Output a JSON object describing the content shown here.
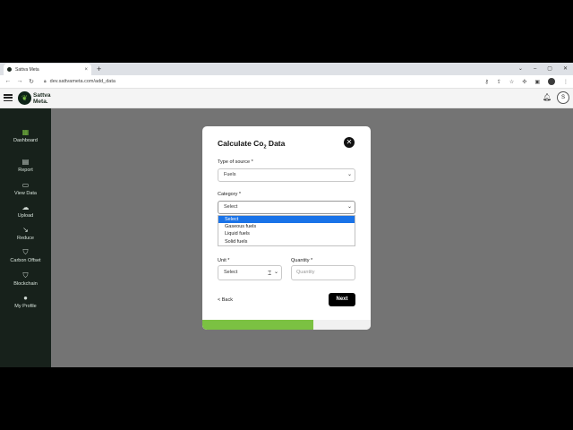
{
  "browser": {
    "tab_title": "Sattva Meta",
    "tab_close": "×",
    "new_tab": "+",
    "url": "dev.sattvameta.com/add_data",
    "window_controls": [
      "⌄",
      "–",
      "▢",
      "✕"
    ]
  },
  "header": {
    "logo_text_line1": "Sattva",
    "logo_text_line2": "Meta.",
    "avatar_initial": "S"
  },
  "sidebar": {
    "items": [
      {
        "label": "Dashboard",
        "icon": "dashboard-icon",
        "active": true
      },
      {
        "label": "Report",
        "icon": "report-icon"
      },
      {
        "label": "View Data",
        "icon": "monitor-icon"
      },
      {
        "label": "Upload",
        "icon": "cloud-upload-icon"
      },
      {
        "label": "Reduce",
        "icon": "trend-down-icon"
      },
      {
        "label": "Carbon Offset",
        "icon": "shield-icon"
      },
      {
        "label": "Blockchain",
        "icon": "shield-check-icon"
      },
      {
        "label": "My Profile",
        "icon": "person-icon"
      }
    ]
  },
  "modal": {
    "title_main": "Calculate Co",
    "title_sub": "2",
    "title_end": " Data",
    "type_of_source_label": "Type of source *",
    "type_of_source_value": "Fuels",
    "category_label": "Category *",
    "category_value": "Select",
    "category_options": [
      "Select",
      "Gaseous fuels",
      "Liquid fuels",
      "Solid fuels"
    ],
    "unit_label": "Unit *",
    "unit_value": "Select",
    "quantity_label": "Quantity *",
    "quantity_placeholder": "Quantity",
    "back_label": "< Back",
    "next_label": "Next",
    "progress_fraction": 0.66
  },
  "colors": {
    "accent_green": "#7bc142",
    "sidebar_bg": "#17211b",
    "option_highlight": "#1a73e8"
  }
}
